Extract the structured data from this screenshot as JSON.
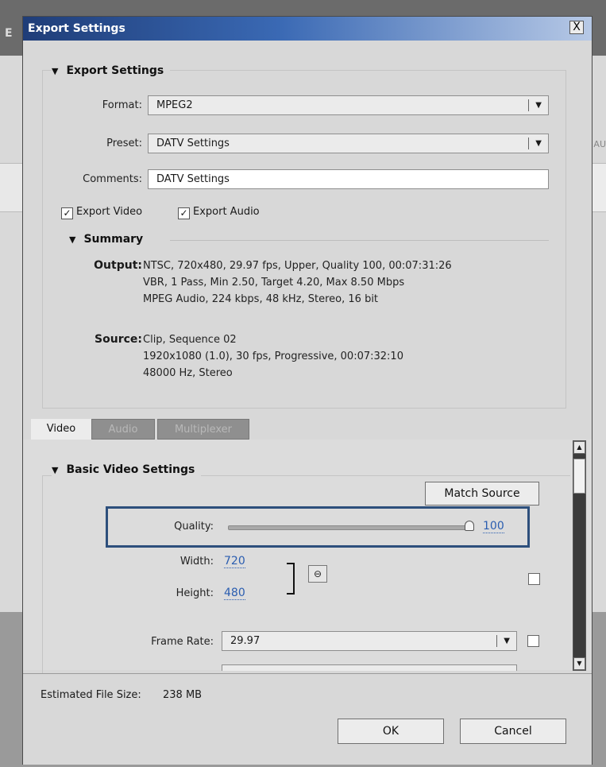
{
  "background_app": {
    "letter": "E",
    "tab_fragment": "AU"
  },
  "window": {
    "title": "Export Settings",
    "close_label": "X"
  },
  "export_settings": {
    "heading": "Export Settings",
    "format_label": "Format:",
    "format_value": "MPEG2",
    "preset_label": "Preset:",
    "preset_value": "DATV Settings",
    "comments_label": "Comments:",
    "comments_value": "DATV Settings",
    "export_video_label": "Export Video",
    "export_video_checked": true,
    "export_audio_label": "Export Audio",
    "export_audio_checked": true
  },
  "summary": {
    "heading": "Summary",
    "output_label": "Output:",
    "output_lines": [
      "NTSC, 720x480, 29.97 fps, Upper, Quality 100, 00:07:31:26",
      "VBR, 1 Pass, Min 2.50, Target 4.20, Max 8.50 Mbps",
      "MPEG Audio, 224 kbps, 48 kHz, Stereo, 16 bit"
    ],
    "source_label": "Source:",
    "source_lines": [
      "Clip, Sequence 02",
      "1920x1080 (1.0), 30 fps, Progressive, 00:07:32:10",
      "48000 Hz, Stereo"
    ]
  },
  "tabs": [
    {
      "label": "Video",
      "active": true
    },
    {
      "label": "Audio",
      "active": false
    },
    {
      "label": "Multiplexer",
      "active": false
    }
  ],
  "basic_video": {
    "heading": "Basic Video Settings",
    "match_source_label": "Match Source",
    "quality_label": "Quality:",
    "quality_value": "100",
    "quality_fraction": 1.0,
    "width_label": "Width:",
    "width_value": "720",
    "height_label": "Height:",
    "height_value": "480",
    "frame_rate_label": "Frame Rate:",
    "frame_rate_value": "29.97"
  },
  "footer": {
    "file_size_label": "Estimated File Size:",
    "file_size_value": "238 MB",
    "ok_label": "OK",
    "cancel_label": "Cancel"
  },
  "icons": {
    "dropdown": "chevron-down-icon",
    "link": "link-chain-icon",
    "triangle": "disclosure-triangle-icon"
  },
  "colors": {
    "title_bar_start": "#1f3d78",
    "highlight_border": "#2d4f7c",
    "link_value": "#2a5db0"
  }
}
